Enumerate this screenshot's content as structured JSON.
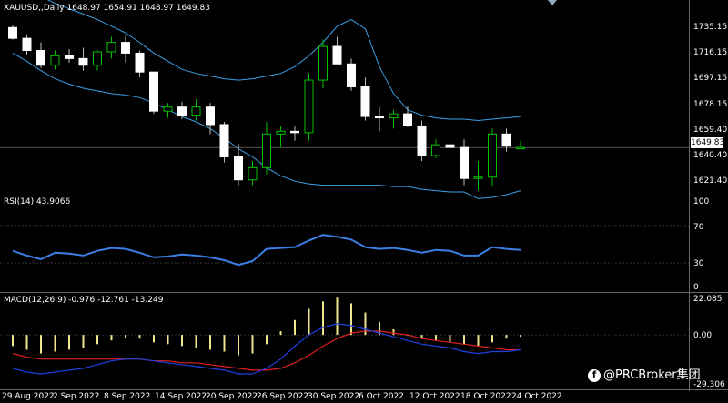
{
  "chart": {
    "symbol_header": "XAUUSD,,Daily  1648.97 1654.91 1648.97 1649.83",
    "rsi_header": "RSI(14) 43.9066",
    "macd_header": "MACD(12,26,9) -0.976 -12.761 -13.249",
    "current_price_tag": "1649.83",
    "watermark": "@PRCBroker集团"
  },
  "price_axis": [
    "1735.15",
    "1716.15",
    "1697.15",
    "1678.15",
    "1659.40",
    "1640.40",
    "1621.40"
  ],
  "rsi_axis": [
    "100",
    "70",
    "30",
    "0"
  ],
  "macd_axis": [
    "22.085",
    "0.00",
    "-29.306"
  ],
  "date_axis": [
    "29 Aug 2022",
    "2 Sep 2022",
    "8 Sep 2022",
    "14 Sep 2022",
    "20 Sep 2022",
    "26 Sep 2022",
    "30 Sep 2022",
    "6 Oct 2022",
    "12 Oct 2022",
    "18 Oct 2022",
    "24 Oct 2022"
  ],
  "colors": {
    "background": "#000000",
    "bull_candle": "#000000",
    "bull_outline": "#00c000",
    "bear_candle": "#ffffff",
    "bands": "#3c9fe6",
    "rsi_line": "#3c7fe6",
    "macd_hist": "#f0e68c",
    "macd_signal": "#e02020",
    "macd_line": "#2040e0",
    "grid": "#333333"
  },
  "chart_data": [
    {
      "type": "candlestick",
      "title": "XAUUSD,,Daily",
      "ylim": [
        1615,
        1750
      ],
      "candles": [
        {
          "o": 1739,
          "h": 1741,
          "l": 1730,
          "c": 1731
        },
        {
          "o": 1731,
          "h": 1734,
          "l": 1719,
          "c": 1722
        },
        {
          "o": 1722,
          "h": 1728,
          "l": 1709,
          "c": 1711
        },
        {
          "o": 1711,
          "h": 1722,
          "l": 1708,
          "c": 1718
        },
        {
          "o": 1718,
          "h": 1723,
          "l": 1713,
          "c": 1716
        },
        {
          "o": 1716,
          "h": 1724,
          "l": 1707,
          "c": 1711
        },
        {
          "o": 1711,
          "h": 1722,
          "l": 1707,
          "c": 1721
        },
        {
          "o": 1721,
          "h": 1732,
          "l": 1716,
          "c": 1728
        },
        {
          "o": 1728,
          "h": 1733,
          "l": 1713,
          "c": 1720
        },
        {
          "o": 1720,
          "h": 1722,
          "l": 1702,
          "c": 1706
        },
        {
          "o": 1706,
          "h": 1706,
          "l": 1675,
          "c": 1677
        },
        {
          "o": 1677,
          "h": 1683,
          "l": 1672,
          "c": 1680
        },
        {
          "o": 1680,
          "h": 1684,
          "l": 1671,
          "c": 1674
        },
        {
          "o": 1674,
          "h": 1686,
          "l": 1670,
          "c": 1680
        },
        {
          "o": 1680,
          "h": 1683,
          "l": 1660,
          "c": 1667
        },
        {
          "o": 1667,
          "h": 1669,
          "l": 1639,
          "c": 1643
        },
        {
          "o": 1643,
          "h": 1653,
          "l": 1622,
          "c": 1626
        },
        {
          "o": 1626,
          "h": 1640,
          "l": 1622,
          "c": 1635
        },
        {
          "o": 1635,
          "h": 1669,
          "l": 1630,
          "c": 1660
        },
        {
          "o": 1660,
          "h": 1666,
          "l": 1650,
          "c": 1662
        },
        {
          "o": 1662,
          "h": 1666,
          "l": 1655,
          "c": 1661
        },
        {
          "o": 1661,
          "h": 1705,
          "l": 1655,
          "c": 1700
        },
        {
          "o": 1700,
          "h": 1730,
          "l": 1694,
          "c": 1725
        },
        {
          "o": 1725,
          "h": 1732,
          "l": 1715,
          "c": 1712
        },
        {
          "o": 1712,
          "h": 1716,
          "l": 1692,
          "c": 1695
        },
        {
          "o": 1695,
          "h": 1702,
          "l": 1670,
          "c": 1673
        },
        {
          "o": 1673,
          "h": 1680,
          "l": 1662,
          "c": 1672
        },
        {
          "o": 1672,
          "h": 1678,
          "l": 1664,
          "c": 1675
        },
        {
          "o": 1675,
          "h": 1681,
          "l": 1665,
          "c": 1666
        },
        {
          "o": 1666,
          "h": 1670,
          "l": 1640,
          "c": 1644
        },
        {
          "o": 1644,
          "h": 1656,
          "l": 1642,
          "c": 1652
        },
        {
          "o": 1652,
          "h": 1660,
          "l": 1640,
          "c": 1650
        },
        {
          "o": 1650,
          "h": 1656,
          "l": 1622,
          "c": 1627
        },
        {
          "o": 1627,
          "h": 1640,
          "l": 1618,
          "c": 1628
        },
        {
          "o": 1628,
          "h": 1664,
          "l": 1621,
          "c": 1660
        },
        {
          "o": 1660,
          "h": 1664,
          "l": 1647,
          "c": 1651
        },
        {
          "o": 1649,
          "h": 1655,
          "l": 1649,
          "c": 1650
        }
      ],
      "bollinger_upper": [
        1770,
        1766,
        1762,
        1757,
        1753,
        1749,
        1745,
        1740,
        1735,
        1728,
        1720,
        1714,
        1708,
        1705,
        1703,
        1701,
        1700,
        1701,
        1703,
        1705,
        1710,
        1718,
        1728,
        1740,
        1745,
        1738,
        1710,
        1690,
        1678,
        1674,
        1672,
        1671,
        1671,
        1670,
        1671,
        1672,
        1673
      ],
      "bollinger_lower": [
        1720,
        1714,
        1707,
        1701,
        1697,
        1694,
        1692,
        1690,
        1689,
        1687,
        1683,
        1678,
        1673,
        1669,
        1664,
        1657,
        1649,
        1643,
        1635,
        1629,
        1625,
        1623,
        1622,
        1622,
        1622,
        1622,
        1622,
        1621,
        1621,
        1619,
        1618,
        1617,
        1617,
        1612,
        1613,
        1615,
        1618
      ]
    },
    {
      "type": "line",
      "title": "RSI(14) 43.9066",
      "ylim": [
        0,
        100
      ],
      "values": [
        43,
        38,
        34,
        41,
        40,
        38,
        43,
        46,
        45,
        41,
        36,
        37,
        39,
        38,
        36,
        33,
        28,
        32,
        45,
        46,
        47,
        54,
        60,
        58,
        55,
        47,
        45,
        46,
        44,
        41,
        44,
        43,
        38,
        38,
        47,
        45,
        44
      ]
    },
    {
      "type": "bar",
      "title": "MACD(12,26,9) -0.976 -12.761 -13.249",
      "ylim": [
        -29.306,
        22.085
      ],
      "histogram": [
        -6,
        -8,
        -10,
        -9,
        -8,
        -7,
        -5,
        -3,
        -2,
        -2,
        -4,
        -5,
        -6,
        -7,
        -8,
        -9,
        -11,
        -10,
        -5,
        2,
        8,
        14,
        18,
        20,
        17,
        12,
        7,
        3,
        0,
        -2,
        -3,
        -4,
        -5,
        -6,
        -4,
        -2,
        -1
      ],
      "series": [
        {
          "name": "MACD",
          "values": [
            -18,
            -20,
            -21,
            -20,
            -19,
            -18,
            -16,
            -14,
            -13,
            -13,
            -14,
            -15,
            -16,
            -17,
            -18,
            -19,
            -21,
            -21,
            -18,
            -13,
            -6,
            0,
            4,
            6,
            5,
            3,
            1,
            -1,
            -3,
            -5,
            -6,
            -7,
            -9,
            -10,
            -9,
            -9,
            -8
          ]
        },
        {
          "name": "Signal",
          "values": [
            -10,
            -12,
            -13,
            -13,
            -13,
            -13,
            -13,
            -13,
            -13,
            -13,
            -14,
            -14,
            -15,
            -15,
            -16,
            -17,
            -18,
            -19,
            -19,
            -18,
            -15,
            -11,
            -6,
            -2,
            1,
            2,
            2,
            1,
            0,
            -2,
            -3,
            -4,
            -5,
            -6,
            -7,
            -8,
            -8
          ]
        }
      ]
    }
  ]
}
